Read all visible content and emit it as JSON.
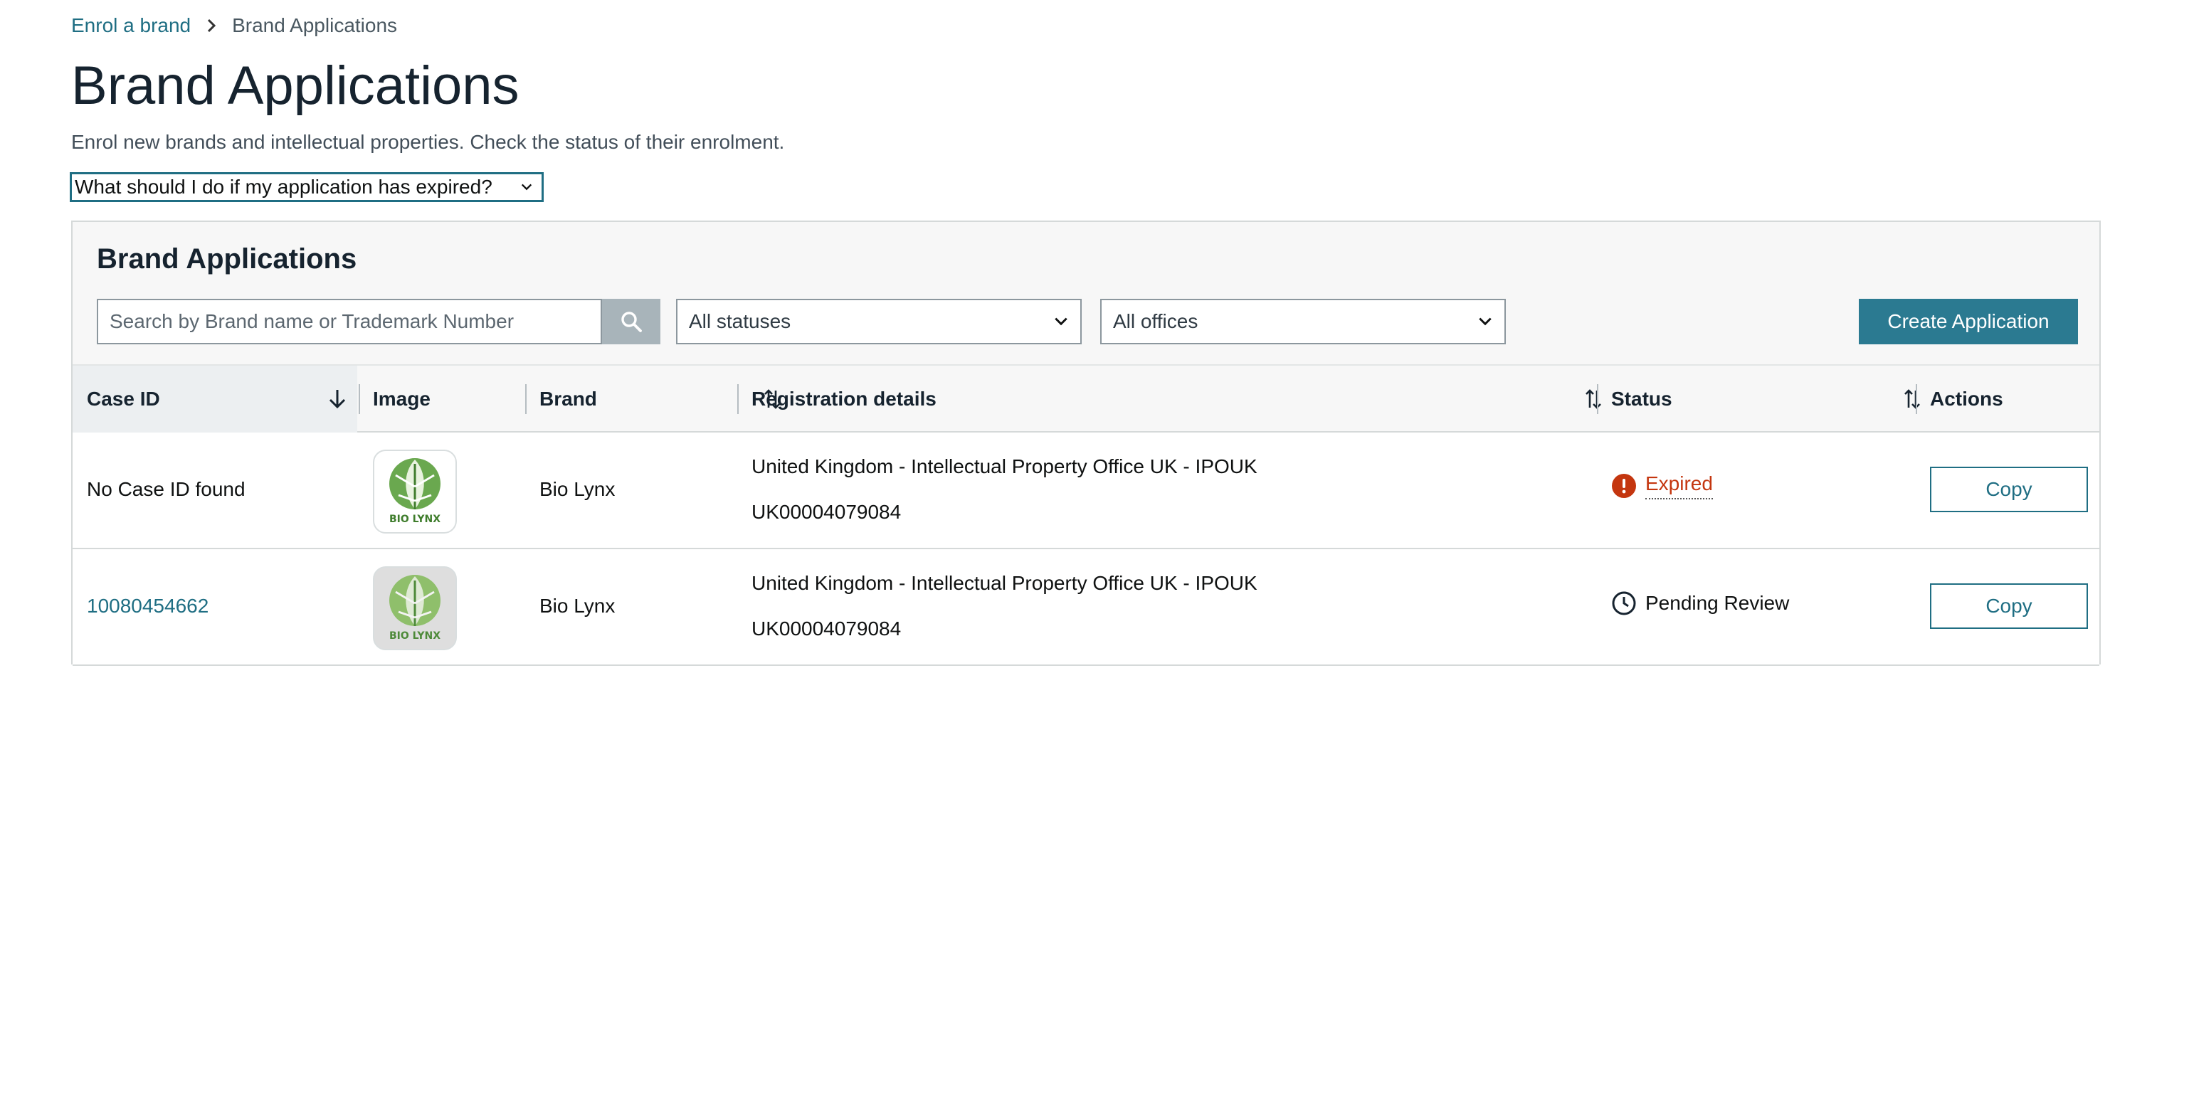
{
  "breadcrumb": {
    "root": "Enrol a brand",
    "current": "Brand Applications"
  },
  "page": {
    "title": "Brand Applications",
    "subtitle": "Enrol new brands and intellectual properties. Check the status of their enrolment."
  },
  "faq": {
    "label": "What should I do if my application has expired?"
  },
  "panel": {
    "title": "Brand Applications",
    "search_placeholder": "Search by Brand name or Trademark Number",
    "status_filter": "All statuses",
    "office_filter": "All offices",
    "create_label": "Create Application"
  },
  "table": {
    "headers": {
      "case_id": "Case ID",
      "image": "Image",
      "brand": "Brand",
      "registration": "Registration details",
      "status": "Status",
      "actions": "Actions"
    },
    "rows": [
      {
        "case_id": "No Case ID found",
        "brand": "Bio Lynx",
        "office": "United Kingdom - Intellectual Property Office UK - IPOUK",
        "number": "UK00004079084",
        "status": "Expired",
        "action": "Copy"
      },
      {
        "case_id": "10080454662",
        "brand": "Bio Lynx",
        "office": "United Kingdom - Intellectual Property Office UK - IPOUK",
        "number": "UK00004079084",
        "status": "Pending Review",
        "action": "Copy"
      }
    ]
  },
  "logo_text": "BIO LYNX",
  "colors": {
    "accent": "#1f6e83",
    "primary_button": "#2b7a91",
    "expired": "#c4360f"
  }
}
